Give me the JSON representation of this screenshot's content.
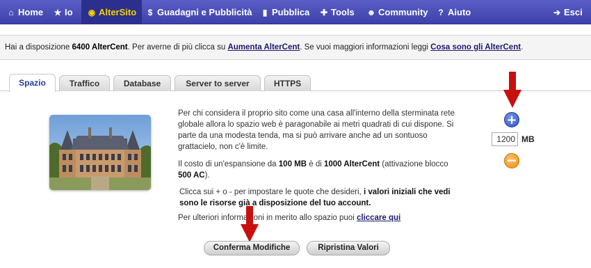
{
  "nav": {
    "items": [
      {
        "label": "Home",
        "icon": "home-icon"
      },
      {
        "label": "Io",
        "icon": "star-icon"
      },
      {
        "label": "AlterSito",
        "icon": "target-icon"
      },
      {
        "label": "Guadagni e Pubblicità",
        "icon": "dollar-icon"
      },
      {
        "label": "Pubblica",
        "icon": "document-icon"
      },
      {
        "label": "Tools",
        "icon": "wrench-icon"
      },
      {
        "label": "Community",
        "icon": "users-icon"
      },
      {
        "label": "Aiuto",
        "icon": "question-icon"
      }
    ],
    "logout": {
      "label": "Esci",
      "icon": "exit-icon"
    },
    "active": "AlterSito"
  },
  "info": {
    "prefix": "Hai a disposizione ",
    "amount": "6400 AlterCent",
    "middle": ". Per averne di più clicca su ",
    "link1": "Aumenta AlterCent",
    "middle2": ". Se vuoi maggiori informazioni leggi ",
    "link2": "Cosa sono gli AlterCent",
    "suffix": "."
  },
  "tabs": [
    "Spazio",
    "Traffico",
    "Database",
    "Server to server",
    "HTTPS"
  ],
  "content": {
    "para1": "Per chi considera il proprio sito come una casa all'interno della sterminata rete globale allora lo spazio web è paragonabile ai metri quadrati di cui dispone. Si parte da una modesta tenda, ma si può arrivare anche ad un sontuoso grattacielo, non c'è limite.",
    "para2_a": "Il costo di un'espansione da ",
    "para2_b": "100 MB",
    "para2_c": " è di ",
    "para2_d": "1000 AlterCent",
    "para2_e": " (attivazione blocco ",
    "para2_f": "500 AC",
    "para2_g": ").",
    "para3_a": "Clicca sui + o - per impostare le quote che desideri, ",
    "para3_b": "i valori iniziali che vedi sono le risorse già a disposizione del tuo account.",
    "para4_a": "Per ulteriori informazioni in merito allo spazio puoi ",
    "para4_link": "cliccare qui"
  },
  "quota": {
    "value": "1200",
    "unit": "MB",
    "plus": "+",
    "minus": "−"
  },
  "buttons": {
    "confirm": "Conferma Modifiche",
    "reset": "Ripristina Valori"
  },
  "colors": {
    "nav_bg": "#3d41a9",
    "active_text": "#f3d100",
    "arrow": "#c8100f",
    "link": "#1a1a6e"
  }
}
